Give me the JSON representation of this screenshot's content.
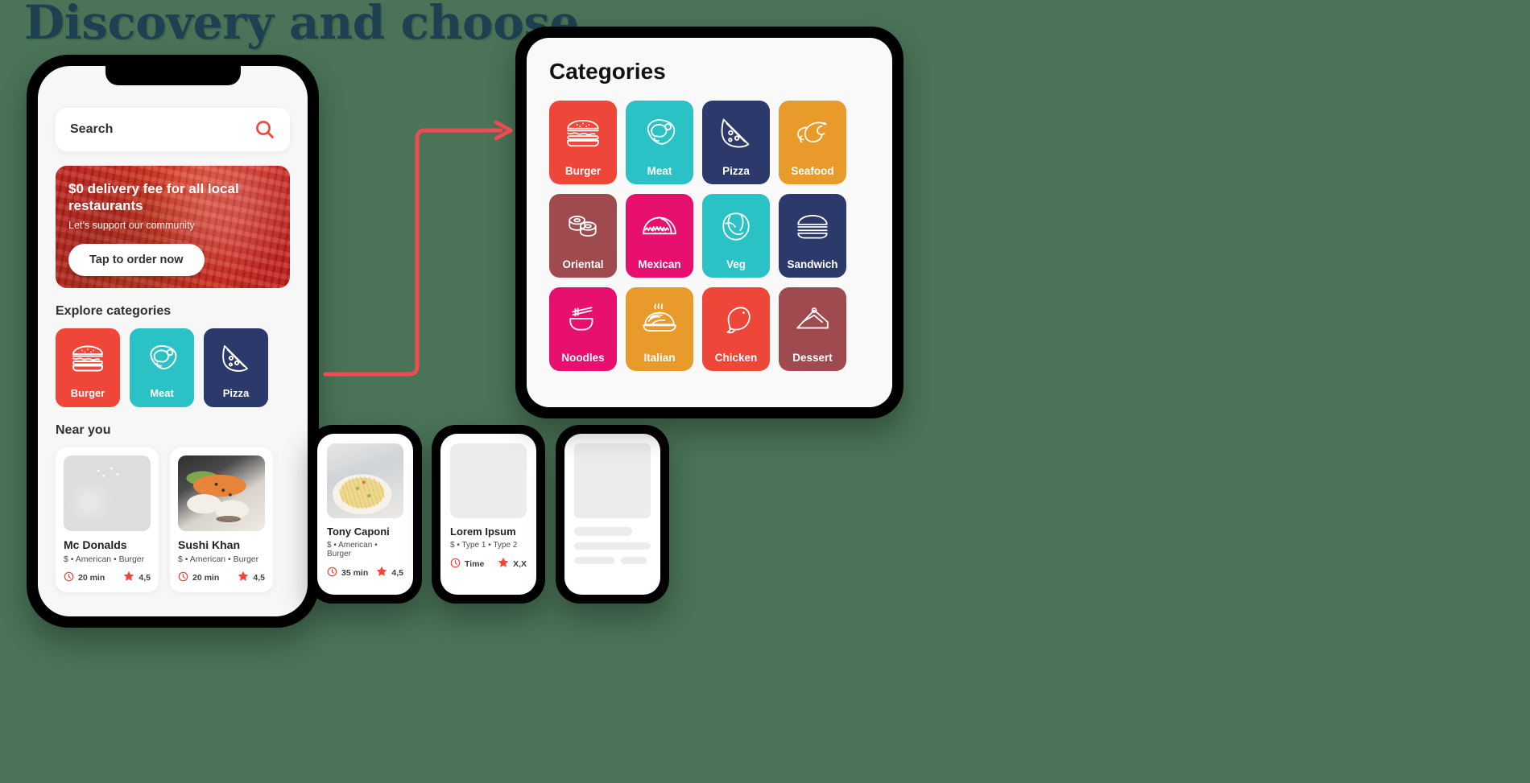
{
  "page": {
    "title": "Discovery and choose",
    "background_color": "#4a7357",
    "title_color": "#1d4150"
  },
  "accent": {
    "red": "#EE4639",
    "teal": "#2AC2C4",
    "navy": "#2B3A6B",
    "orange": "#E89A2B",
    "maroon": "#9E4A4E",
    "magenta": "#E8106E",
    "arrow": "#F04A52"
  },
  "phone": {
    "search": {
      "label": "Search",
      "icon": "search-icon"
    },
    "promo": {
      "title": "$0 delivery fee for all local restaurants",
      "subtitle": "Let’s support our community",
      "button": "Tap to order now"
    },
    "explore": {
      "heading": "Explore categories",
      "tiles": [
        {
          "label": "Burger",
          "icon": "burger-icon",
          "color": "#EE4639"
        },
        {
          "label": "Meat",
          "icon": "meat-icon",
          "color": "#2AC2C4"
        },
        {
          "label": "Pizza",
          "icon": "pizza-icon",
          "color": "#2B3A6B"
        }
      ]
    },
    "near_you": {
      "heading": "Near you",
      "cards": [
        {
          "name": "Mc Donalds",
          "meta": "$ • American • Burger",
          "time": "20 min",
          "rating": "4,5",
          "image": "burger-photo"
        },
        {
          "name": "Sushi Khan",
          "meta": "$ • American • Burger",
          "time": "20 min",
          "rating": "4,5",
          "image": "sushi-photo"
        }
      ]
    }
  },
  "mini_phones": [
    {
      "name": "Tony Caponi",
      "meta": "$ • American • Burger",
      "time": "35 min",
      "rating": "4,5",
      "image": "pasta-photo",
      "state": "filled"
    },
    {
      "name": "Lorem Ipsum",
      "meta": "$ • Type 1 • Type 2",
      "time": "Time",
      "rating": "X,X",
      "image": "placeholder",
      "state": "placeholder"
    },
    {
      "name": "",
      "meta": "",
      "time": "",
      "rating": "",
      "image": "placeholder",
      "state": "skeleton"
    }
  ],
  "categories_panel": {
    "title": "Categories",
    "tiles": [
      {
        "label": "Burger",
        "icon": "burger-icon",
        "color": "#EE4639"
      },
      {
        "label": "Meat",
        "icon": "meat-icon",
        "color": "#2AC2C4"
      },
      {
        "label": "Pizza",
        "icon": "pizza-icon",
        "color": "#2B3A6B"
      },
      {
        "label": "Seafood",
        "icon": "shrimp-icon",
        "color": "#E89A2B"
      },
      {
        "label": "Oriental",
        "icon": "sushi-icon",
        "color": "#9E4A4E"
      },
      {
        "label": "Mexican",
        "icon": "taco-icon",
        "color": "#E8106E"
      },
      {
        "label": "Veg",
        "icon": "lettuce-icon",
        "color": "#2AC2C4"
      },
      {
        "label": "Sandwich",
        "icon": "sandwich-icon",
        "color": "#2B3A6B"
      },
      {
        "label": "Noodles",
        "icon": "noodles-icon",
        "color": "#E8106E"
      },
      {
        "label": "Italian",
        "icon": "pasta-icon",
        "color": "#E89A2B"
      },
      {
        "label": "Chicken",
        "icon": "chicken-icon",
        "color": "#EE4639"
      },
      {
        "label": "Dessert",
        "icon": "cake-icon",
        "color": "#9E4A4E"
      }
    ]
  }
}
